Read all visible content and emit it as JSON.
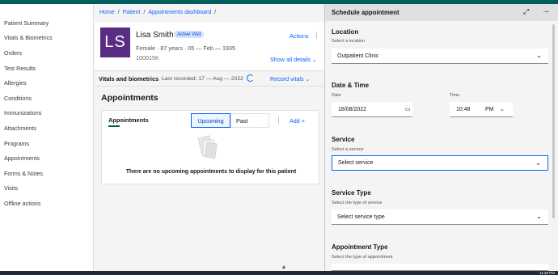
{
  "nav": {
    "items": [
      "Patient Summary",
      "Vitals & Biometrics",
      "Orders",
      "Test Results",
      "Allergies",
      "Conditions",
      "Immunizations",
      "Attachments",
      "Programs",
      "Appointments",
      "Forms & Notes",
      "Visits",
      "Offline actions"
    ]
  },
  "breadcrumb": {
    "home": "Home",
    "patient": "Patient",
    "dashboard": "Appointments dashboard",
    "sep": "/"
  },
  "patient": {
    "initials": "LS",
    "name": "Lisa Smith",
    "badge": "Active Visit",
    "info": "Female · 87 years · 05 — Feb — 1935",
    "id": "100015K",
    "actions": "Actions",
    "show_all": "Show all details ⌄"
  },
  "vitals": {
    "title": "Vitals and biometrics",
    "last_recorded": "Last recorded: 17 — Aug — 2022",
    "record": "Record vitals ⌄"
  },
  "appointments": {
    "heading": "Appointments",
    "card_title": "Appointments",
    "upcoming": "Upcoming",
    "past": "Past",
    "add": "Add +",
    "empty": "There are no upcoming appointments to display for this patient"
  },
  "panel": {
    "title": "Schedule appointment",
    "maximize": "⤢",
    "close": "→",
    "location_title": "Location",
    "location_sub": "Select a location",
    "location_value": "Outpatient Clinic",
    "datetime_title": "Date & Time",
    "date_label": "Date",
    "date_value": "18/08/2022",
    "time_label": "Time",
    "time_value": "10:48",
    "ampm": "PM",
    "service_title": "Service",
    "service_sub": "Select a service",
    "service_value": "Select service",
    "service_type_title": "Service Type",
    "service_type_sub": "Select the type of service",
    "service_type_value": "Select service type",
    "appt_type_title": "Appointment Type",
    "appt_type_sub": "Select the type of appointment"
  },
  "taskbar": {
    "clock": "11:28 PM"
  },
  "colors": {
    "brand": "#005d5d",
    "link": "#0f62fe",
    "avatar": "#5a2d82"
  }
}
